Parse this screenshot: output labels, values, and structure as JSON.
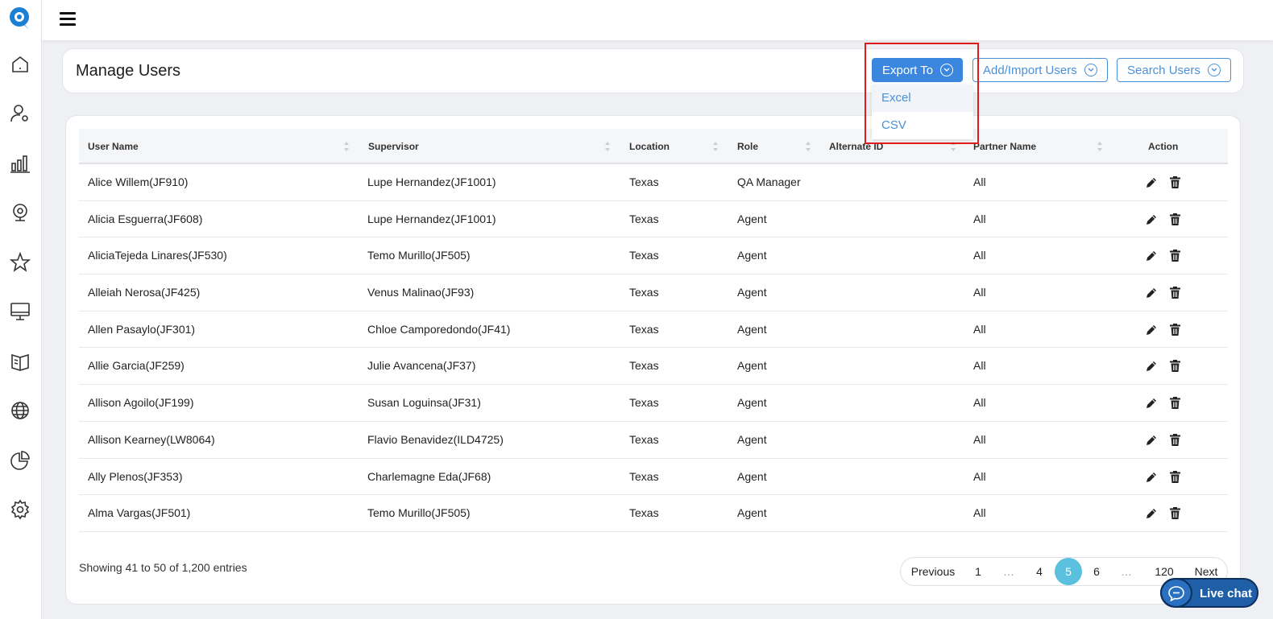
{
  "header": {
    "title": "Manage Users"
  },
  "buttons": {
    "export": "Export To",
    "add": "Add/Import Users",
    "search": "Search Users"
  },
  "export_menu": {
    "items": [
      "Excel",
      "CSV"
    ]
  },
  "table": {
    "columns": [
      "User Name",
      "Supervisor",
      "Location",
      "Role",
      "Alternate ID",
      "Partner Name",
      "Action"
    ],
    "rows": [
      {
        "user": "Alice Willem(JF910)",
        "supervisor": "Lupe Hernandez(JF1001)",
        "location": "Texas",
        "role": "QA Manager",
        "alt": "",
        "partner": "All"
      },
      {
        "user": "Alicia Esguerra(JF608)",
        "supervisor": "Lupe Hernandez(JF1001)",
        "location": "Texas",
        "role": "Agent",
        "alt": "",
        "partner": "All"
      },
      {
        "user": "AliciaTejeda Linares(JF530)",
        "supervisor": "Temo Murillo(JF505)",
        "location": "Texas",
        "role": "Agent",
        "alt": "",
        "partner": "All"
      },
      {
        "user": "Alleiah Nerosa(JF425)",
        "supervisor": "Venus Malinao(JF93)",
        "location": "Texas",
        "role": "Agent",
        "alt": "",
        "partner": "All"
      },
      {
        "user": "Allen Pasaylo(JF301)",
        "supervisor": "Chloe Camporedondo(JF41)",
        "location": "Texas",
        "role": "Agent",
        "alt": "",
        "partner": "All"
      },
      {
        "user": "Allie Garcia(JF259)",
        "supervisor": "Julie Avancena(JF37)",
        "location": "Texas",
        "role": "Agent",
        "alt": "",
        "partner": "All"
      },
      {
        "user": "Allison Agoilo(JF199)",
        "supervisor": "Susan Loguinsa(JF31)",
        "location": "Texas",
        "role": "Agent",
        "alt": "",
        "partner": "All"
      },
      {
        "user": "Allison Kearney(LW8064)",
        "supervisor": "Flavio Benavidez(ILD4725)",
        "location": "Texas",
        "role": "Agent",
        "alt": "",
        "partner": "All"
      },
      {
        "user": "Ally Plenos(JF353)",
        "supervisor": "Charlemagne Eda(JF68)",
        "location": "Texas",
        "role": "Agent",
        "alt": "",
        "partner": "All"
      },
      {
        "user": "Alma Vargas(JF501)",
        "supervisor": "Temo Murillo(JF505)",
        "location": "Texas",
        "role": "Agent",
        "alt": "",
        "partner": "All"
      }
    ]
  },
  "footer": {
    "showing": "Showing 41 to 50 of 1,200 entries"
  },
  "pagination": {
    "previous": "Previous",
    "next": "Next",
    "pages": [
      "1",
      "…",
      "4",
      "5",
      "6",
      "…",
      "120"
    ],
    "current": "5"
  },
  "livechat": {
    "label": "Live chat"
  },
  "colors": {
    "primary": "#3b87e0",
    "outline": "#4a90d9",
    "active_page": "#5bc0de",
    "highlight": "#e01b1b",
    "livechat": "#1f5fa8"
  },
  "sidebar_icons": [
    "home-icon",
    "user-settings-icon",
    "bar-chart-icon",
    "webcam-icon",
    "star-icon",
    "monitor-icon",
    "book-icon",
    "globe-icon",
    "pie-chart-icon",
    "gear-icon"
  ]
}
